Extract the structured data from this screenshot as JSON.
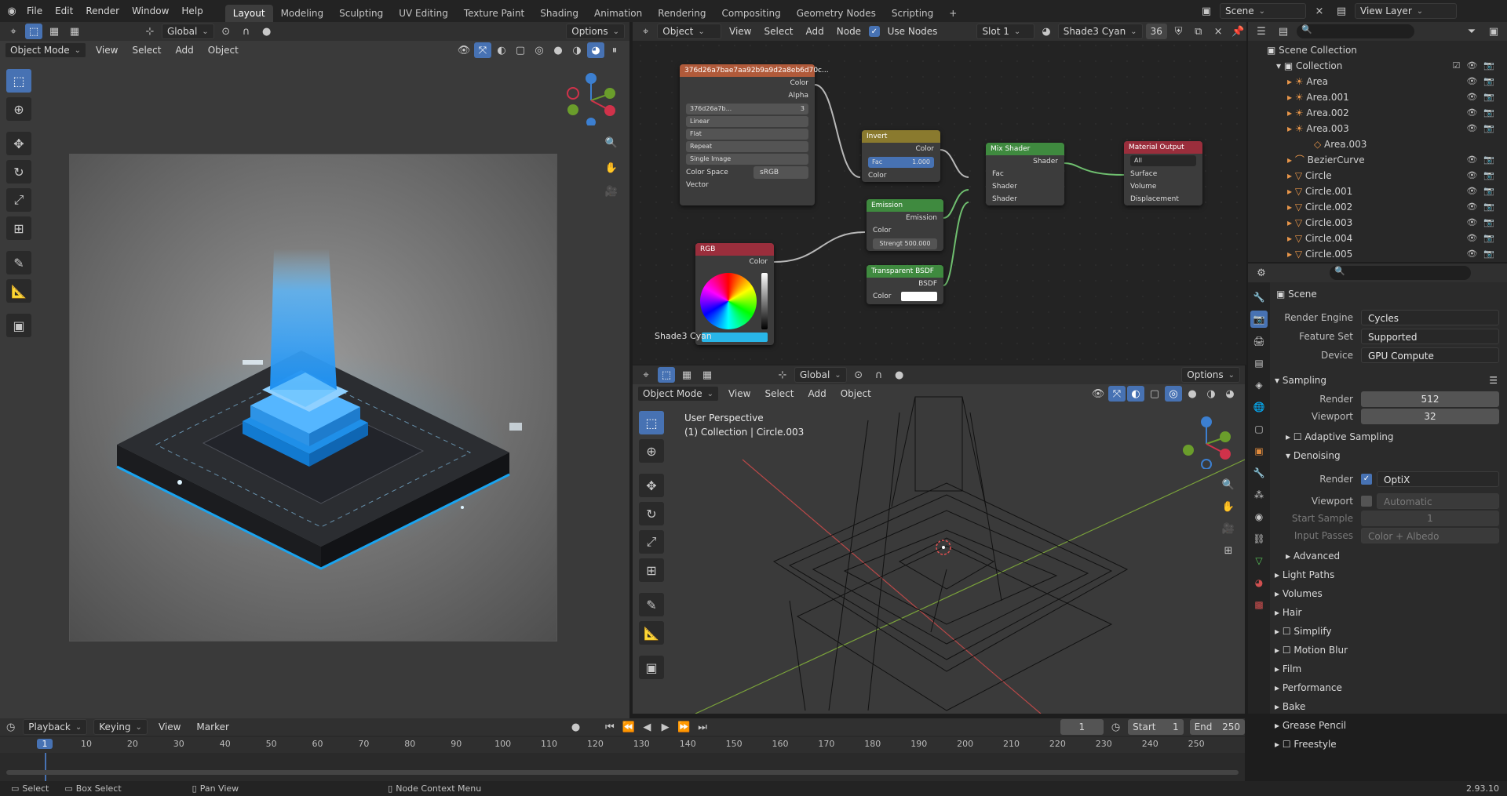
{
  "topbar": {
    "menus": [
      "File",
      "Edit",
      "Render",
      "Window",
      "Help"
    ],
    "workspaces": [
      "Layout",
      "Modeling",
      "Sculpting",
      "UV Editing",
      "Texture Paint",
      "Shading",
      "Animation",
      "Rendering",
      "Compositing",
      "Geometry Nodes",
      "Scripting"
    ],
    "active_workspace": "Layout",
    "scene": "Scene",
    "view_layer": "View Layer"
  },
  "viewport_left": {
    "mode": "Object Mode",
    "menus": [
      "View",
      "Select",
      "Add",
      "Object"
    ],
    "transform": "Global",
    "options": "Options"
  },
  "node_editor": {
    "object": "Object",
    "menus": [
      "View",
      "Select",
      "Add",
      "Node"
    ],
    "use_nodes": "Use Nodes",
    "slot": "Slot 1",
    "material": "Shade3 Cyan",
    "users": "36",
    "image_node": {
      "title": "376d26a7bae7aa92b9a9d2a8eb6d70c...",
      "out_color": "Color",
      "out_alpha": "Alpha",
      "image_name": "376d26a7b...",
      "image_users": "3",
      "interp": "Linear",
      "proj": "Flat",
      "ext": "Repeat",
      "source": "Single Image",
      "cs_label": "Color Space",
      "cs_value": "sRGB",
      "in_vector": "Vector"
    },
    "invert_node": {
      "title": "Invert",
      "out": "Color",
      "fac_label": "Fac",
      "fac_value": "1.000",
      "in": "Color"
    },
    "mix_node": {
      "title": "Mix Shader",
      "out": "Shader",
      "fac": "Fac",
      "shader1": "Shader",
      "shader2": "Shader"
    },
    "output_node": {
      "title": "Material Output",
      "target": "All",
      "surface": "Surface",
      "volume": "Volume",
      "displacement": "Displacement"
    },
    "emission_node": {
      "title": "Emission",
      "out": "Emission",
      "color": "Color",
      "strength": "Strengt 500.000"
    },
    "transparent_node": {
      "title": "Transparent BSDF",
      "out": "BSDF",
      "color": "Color"
    },
    "rgb_node": {
      "title": "RGB",
      "out": "Color"
    },
    "material_label": "Shade3 Cyan"
  },
  "viewport_right": {
    "transform": "Global",
    "options": "Options",
    "mode": "Object Mode",
    "menus": [
      "View",
      "Select",
      "Add",
      "Object"
    ],
    "perspective": "User Perspective",
    "collection_info": "(1) Collection | Circle.003"
  },
  "outliner": {
    "root": "Scene Collection",
    "collection": "Collection",
    "items": [
      {
        "name": "Area",
        "indent": 1
      },
      {
        "name": "Area.001",
        "indent": 1
      },
      {
        "name": "Area.002",
        "indent": 1
      },
      {
        "name": "Area.003",
        "indent": 1
      },
      {
        "name": "Area.003",
        "indent": 2
      },
      {
        "name": "BezierCurve",
        "indent": 1
      },
      {
        "name": "Circle",
        "indent": 1
      },
      {
        "name": "Circle.001",
        "indent": 1
      },
      {
        "name": "Circle.002",
        "indent": 1
      },
      {
        "name": "Circle.003",
        "indent": 1
      },
      {
        "name": "Circle.004",
        "indent": 1
      },
      {
        "name": "Circle.005",
        "indent": 1
      }
    ]
  },
  "properties": {
    "scene": "Scene",
    "render_engine_label": "Render Engine",
    "render_engine": "Cycles",
    "feature_set_label": "Feature Set",
    "feature_set": "Supported",
    "device_label": "Device",
    "device": "GPU Compute",
    "sampling": "Sampling",
    "render_label": "Render",
    "render_samples": "512",
    "viewport_label": "Viewport",
    "viewport_samples": "32",
    "adaptive": "Adaptive Sampling",
    "denoising": "Denoising",
    "den_render_label": "Render",
    "den_render": "OptiX",
    "den_viewport_label": "Viewport",
    "den_viewport": "Automatic",
    "start_sample_label": "Start Sample",
    "start_sample": "1",
    "input_passes_label": "Input Passes",
    "input_passes": "Color + Albedo",
    "advanced": "Advanced",
    "sections": [
      "Light Paths",
      "Volumes",
      "Hair",
      "Simplify",
      "Motion Blur",
      "Film",
      "Performance",
      "Bake",
      "Grease Pencil",
      "Freestyle"
    ]
  },
  "timeline": {
    "menus": [
      "Playback",
      "Keying",
      "View",
      "Marker"
    ],
    "current_frame": "1",
    "start_label": "Start",
    "start": "1",
    "end_label": "End",
    "end": "250",
    "ticks": [
      "1",
      "10",
      "20",
      "30",
      "40",
      "50",
      "60",
      "70",
      "80",
      "90",
      "100",
      "110",
      "120",
      "130",
      "140",
      "150",
      "160",
      "170",
      "180",
      "190",
      "200",
      "210",
      "220",
      "230",
      "240",
      "250"
    ]
  },
  "statusbar": {
    "select": "Select",
    "box_select": "Box Select",
    "pan_view": "Pan View",
    "node_menu": "Node Context Menu",
    "version": "2.93.10"
  },
  "colors": {
    "accent": "#4772b3",
    "cyan": "#29b6e8",
    "node_image": "#b05a3a",
    "node_invert": "#8a7a2e",
    "node_shader": "#3f8a3f",
    "node_output": "#9a2e3c",
    "node_rgb": "#9a2e3c"
  }
}
